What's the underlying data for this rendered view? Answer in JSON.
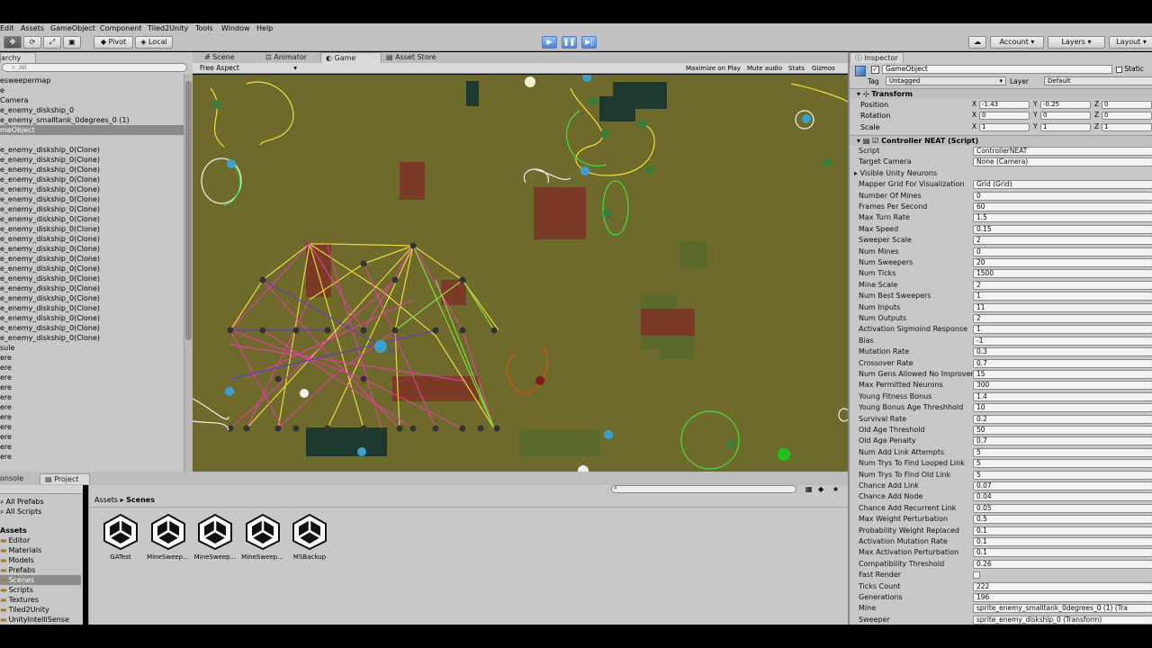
{
  "menu": [
    "Edit",
    "Assets",
    "GameObject",
    "Component",
    "Tiled2Unity",
    "Tools",
    "Window",
    "Help"
  ],
  "toolbar": {
    "pivot": "Pivot",
    "local": "Local",
    "account": "Account",
    "layers": "Layers",
    "layout": "Layout"
  },
  "hierarchy": {
    "tab": "archy",
    "search_placeholder": "All",
    "items": [
      "esweepermap",
      "e",
      " Camera",
      "e_enemy_diskship_0",
      "e_enemy_smalltank_0degrees_0 (1)",
      "meObject",
      "",
      "e_enemy_diskship_0(Clone)",
      "e_enemy_diskship_0(Clone)",
      "e_enemy_diskship_0(Clone)",
      "e_enemy_diskship_0(Clone)",
      "e_enemy_diskship_0(Clone)",
      "e_enemy_diskship_0(Clone)",
      "e_enemy_diskship_0(Clone)",
      "e_enemy_diskship_0(Clone)",
      "e_enemy_diskship_0(Clone)",
      "e_enemy_diskship_0(Clone)",
      "e_enemy_diskship_0(Clone)",
      "e_enemy_diskship_0(Clone)",
      "e_enemy_diskship_0(Clone)",
      "e_enemy_diskship_0(Clone)",
      "e_enemy_diskship_0(Clone)",
      "e_enemy_diskship_0(Clone)",
      "e_enemy_diskship_0(Clone)",
      "e_enemy_diskship_0(Clone)",
      "e_enemy_diskship_0(Clone)",
      "e_enemy_diskship_0(Clone)",
      "sule",
      "ere",
      "ere",
      "ere",
      "ere",
      "ere",
      "ere",
      "ere",
      "ere",
      "ere",
      "ere",
      "ere"
    ]
  },
  "center_tabs": {
    "scene": "Scene",
    "animator": "Animator",
    "game": "Game",
    "asset_store": "Asset Store"
  },
  "game_bar": {
    "aspect": "Free Aspect",
    "maximize": "Maximize on Play",
    "mute": "Mute audio",
    "stats": "Stats",
    "gizmos": "Gizmos"
  },
  "bottom": {
    "console_tab": "onsole",
    "project_tab": "Project",
    "breadcrumb_root": "Assets",
    "breadcrumb_leaf": "Scenes",
    "favorites": [
      "All Prefabs",
      "All Scripts"
    ],
    "assets_header": "Assets",
    "folders": [
      "Editor",
      "Materials",
      "Models",
      "Prefabs",
      "Scenes",
      "Scripts",
      "Textures",
      "Tiled2Unity",
      "UnityIntelliSense"
    ],
    "scenes": [
      "GATest",
      "MineSweep...",
      "MineSweep...",
      "MineSweep...",
      "MSBackup"
    ]
  },
  "inspector": {
    "tab": "Inspector",
    "object_name": "GameObject",
    "static_label": "Static",
    "tag_label": "Tag",
    "tag_value": "Untagged",
    "layer_label": "Layer",
    "layer_value": "Default",
    "transform_title": "Transform",
    "position_label": "Position",
    "position": [
      "-1.43",
      "-0.25",
      "0"
    ],
    "rotation_label": "Rotation",
    "rotation": [
      "0",
      "0",
      "0"
    ],
    "scale_label": "Scale",
    "scale": [
      "1",
      "1",
      "1"
    ],
    "controller_title": "Controller NEAT (Script)",
    "fields": [
      {
        "label": "Script",
        "value": "ControllerNEAT"
      },
      {
        "label": "Target Camera",
        "value": "None (Camera)"
      },
      {
        "label": "Visible Unity Neurons",
        "value": ""
      },
      {
        "label": "Mapper Grid For Visualization",
        "value": "Grid (Grid)"
      },
      {
        "label": "Number Of Mines",
        "value": "0"
      },
      {
        "label": "Frames Per Second",
        "value": "60"
      },
      {
        "label": "Max Turn Rate",
        "value": "1.5"
      },
      {
        "label": "Max Speed",
        "value": "0.15"
      },
      {
        "label": "Sweeper Scale",
        "value": "2"
      },
      {
        "label": "Num Mines",
        "value": "0"
      },
      {
        "label": "Num Sweepers",
        "value": "20"
      },
      {
        "label": "Num Ticks",
        "value": "1500"
      },
      {
        "label": "Mine Scale",
        "value": "2"
      },
      {
        "label": "Num Best Sweepers",
        "value": "1"
      },
      {
        "label": "Num Inputs",
        "value": "11"
      },
      {
        "label": "Num Outputs",
        "value": "2"
      },
      {
        "label": "Activation Sigmoind Response",
        "value": "1"
      },
      {
        "label": "Bias",
        "value": "-1"
      },
      {
        "label": "Mutation Rate",
        "value": "0.3"
      },
      {
        "label": "Crossover Rate",
        "value": "0.7"
      },
      {
        "label": "Num Gens Allowed No Improvement",
        "value": "15"
      },
      {
        "label": "Max Permitted Neurons",
        "value": "300"
      },
      {
        "label": "Young Fitness Bonus",
        "value": "1.4"
      },
      {
        "label": "Young Bonus Age Threshhold",
        "value": "10"
      },
      {
        "label": "Survival Rate",
        "value": "0.2"
      },
      {
        "label": "Old Age Threshold",
        "value": "50"
      },
      {
        "label": "Old Age Penalty",
        "value": "0.7"
      },
      {
        "label": "Num Add Link Attempts",
        "value": "5"
      },
      {
        "label": "Num Trys To Find Looped Link",
        "value": "5"
      },
      {
        "label": "Num Trys To Find Old Link",
        "value": "5"
      },
      {
        "label": "Chance Add Link",
        "value": "0.07"
      },
      {
        "label": "Chance Add Node",
        "value": "0.04"
      },
      {
        "label": "Chance Add Recurrent Link",
        "value": "0.05"
      },
      {
        "label": "Max Weight Perturbation",
        "value": "0.5"
      },
      {
        "label": "Probability Weight Replaced",
        "value": "0.1"
      },
      {
        "label": "Activation Mutation Rate",
        "value": "0.1"
      },
      {
        "label": "Max Activation Perturbation",
        "value": "0.1"
      },
      {
        "label": "Compatibility Threshold",
        "value": "0.26"
      },
      {
        "label": "Fast Render",
        "value": ""
      },
      {
        "label": "Ticks Count",
        "value": "222"
      },
      {
        "label": "Generations",
        "value": "196"
      },
      {
        "label": "Mine",
        "value": "sprite_enemy_smalltank_0degrees_0 (1) (Tra"
      },
      {
        "label": "Sweeper",
        "value": "sprite_enemy_diskship_0 (Transform)"
      }
    ]
  }
}
